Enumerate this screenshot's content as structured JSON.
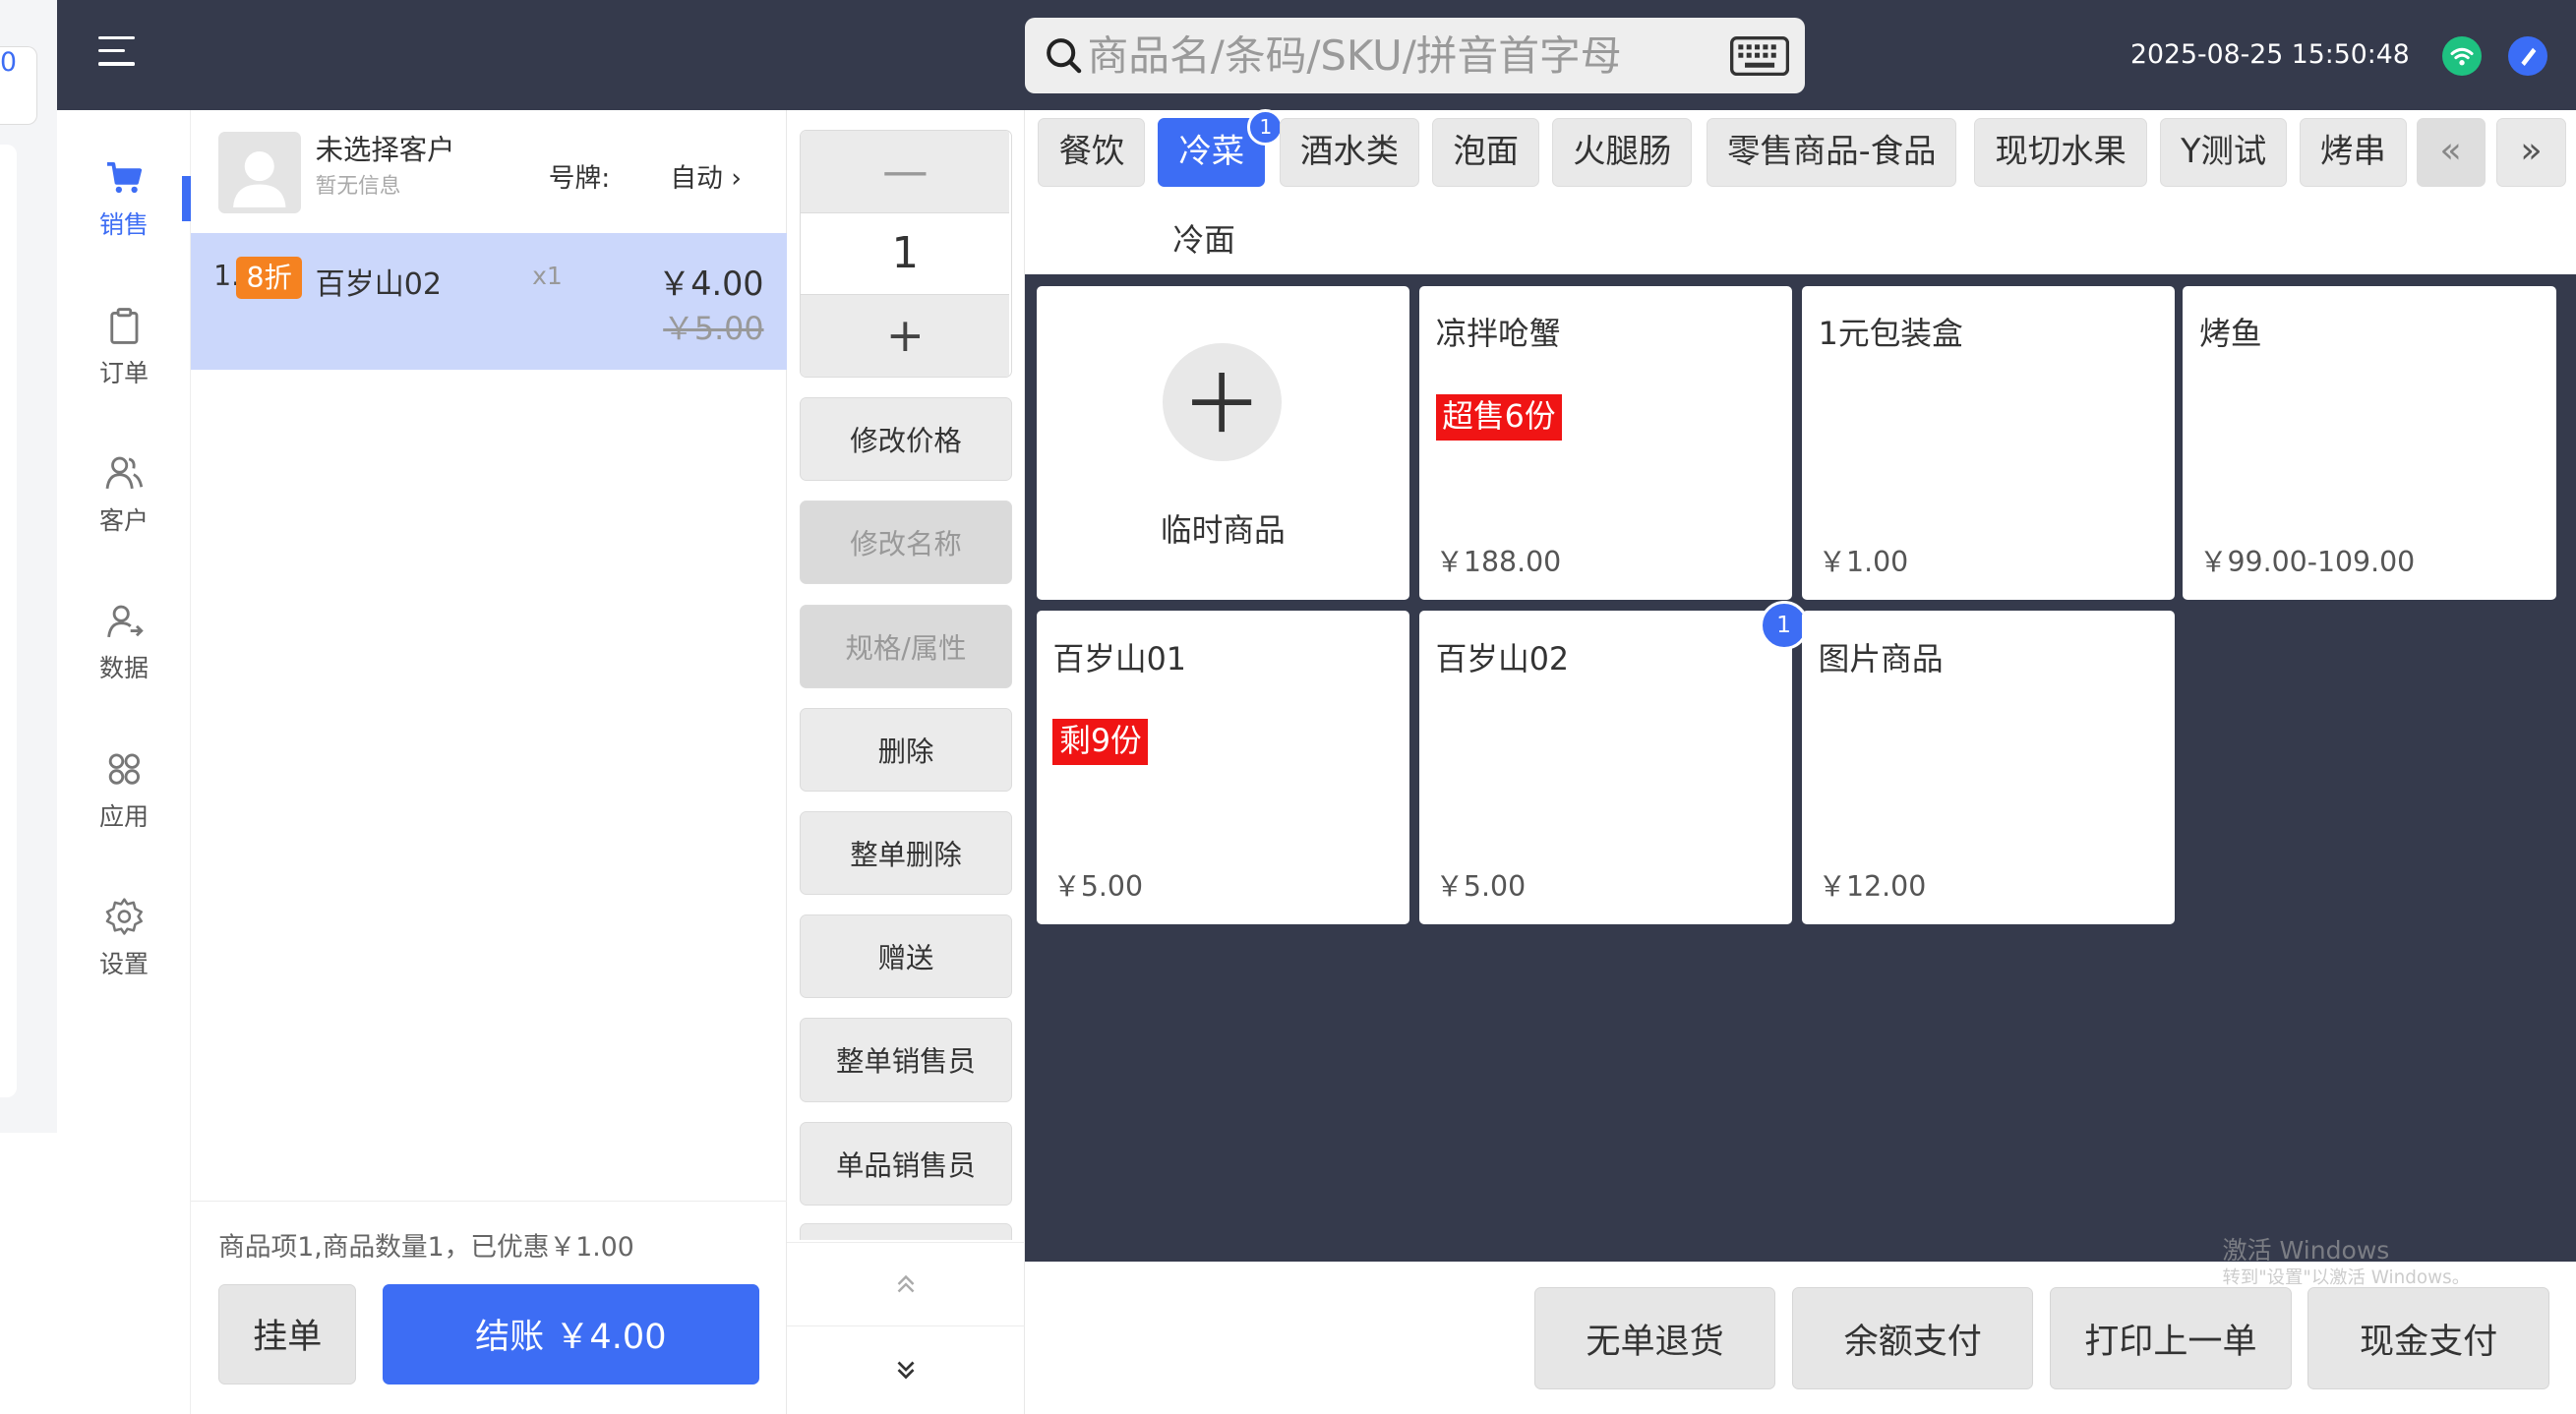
{
  "header": {
    "search_placeholder": "商品名/条码/SKU/拼音首字母",
    "datetime": "2025-08-25 15:50:48"
  },
  "left_strip": {
    "partial_text": "0"
  },
  "nav": [
    {
      "label": "销售",
      "icon": "cart-icon",
      "active": true
    },
    {
      "label": "订单",
      "icon": "clipboard-icon"
    },
    {
      "label": "客户",
      "icon": "users-icon"
    },
    {
      "label": "数据",
      "icon": "user-data-icon"
    },
    {
      "label": "应用",
      "icon": "apps-icon"
    },
    {
      "label": "设置",
      "icon": "gear-icon"
    }
  ],
  "customer": {
    "name": "未选择客户",
    "sub": "暂无信息",
    "plate_label": "号牌:",
    "plate_value": "自动 ›"
  },
  "cart": {
    "items": [
      {
        "index": "1.",
        "discount": "8折",
        "name": "百岁山02",
        "qty": "x1",
        "price": "￥4.00",
        "original": "￥5.00"
      }
    ],
    "summary": "商品项1,商品数量1，已优惠￥1.00",
    "hold_label": "挂单",
    "checkout_label": "结账 ￥4.00"
  },
  "stepper": {
    "minus": "—",
    "value": "1",
    "plus": "+"
  },
  "actions": [
    {
      "label": "修改价格",
      "disabled": false
    },
    {
      "label": "修改名称",
      "disabled": true
    },
    {
      "label": "规格/属性",
      "disabled": true
    },
    {
      "label": "删除",
      "disabled": false
    },
    {
      "label": "整单删除",
      "disabled": false
    },
    {
      "label": "赠送",
      "disabled": false
    },
    {
      "label": "整单销售员",
      "disabled": false
    },
    {
      "label": "单品销售员",
      "disabled": false
    }
  ],
  "categories": [
    {
      "label": "餐饮"
    },
    {
      "label": "冷菜",
      "active": true,
      "badge": "1"
    },
    {
      "label": "酒水类"
    },
    {
      "label": "泡面"
    },
    {
      "label": "火腿肠"
    },
    {
      "label": "零售商品-食品"
    },
    {
      "label": "现切水果"
    },
    {
      "label": "Y测试"
    },
    {
      "label": "烤串"
    }
  ],
  "category_nav": {
    "prev": "«",
    "next": "»"
  },
  "subcategory": "冷面",
  "products": [
    {
      "name": "临时商品",
      "temp": true
    },
    {
      "name": "凉拌呛蟹",
      "tag": "超售6份",
      "price": "￥188.00"
    },
    {
      "name": "1元包装盒",
      "price": "￥1.00"
    },
    {
      "name": "烤鱼",
      "price": "￥99.00-109.00"
    },
    {
      "name": "百岁山01",
      "tag": "剩9份",
      "price": "￥5.00"
    },
    {
      "name": "百岁山02",
      "price": "￥5.00",
      "badge": "1"
    },
    {
      "name": "图片商品",
      "price": "￥12.00"
    }
  ],
  "bottom_buttons": [
    "无单退货",
    "余额支付",
    "打印上一单",
    "现金支付"
  ],
  "watermark": {
    "line1": "激活 Windows",
    "line2": "转到\"设置\"以激活 Windows。"
  },
  "colors": {
    "primary": "#3d6df4",
    "dark": "#353a4c",
    "tag_red": "#f01414",
    "discount_orange": "#f58220",
    "wifi_green": "#1ec281"
  }
}
